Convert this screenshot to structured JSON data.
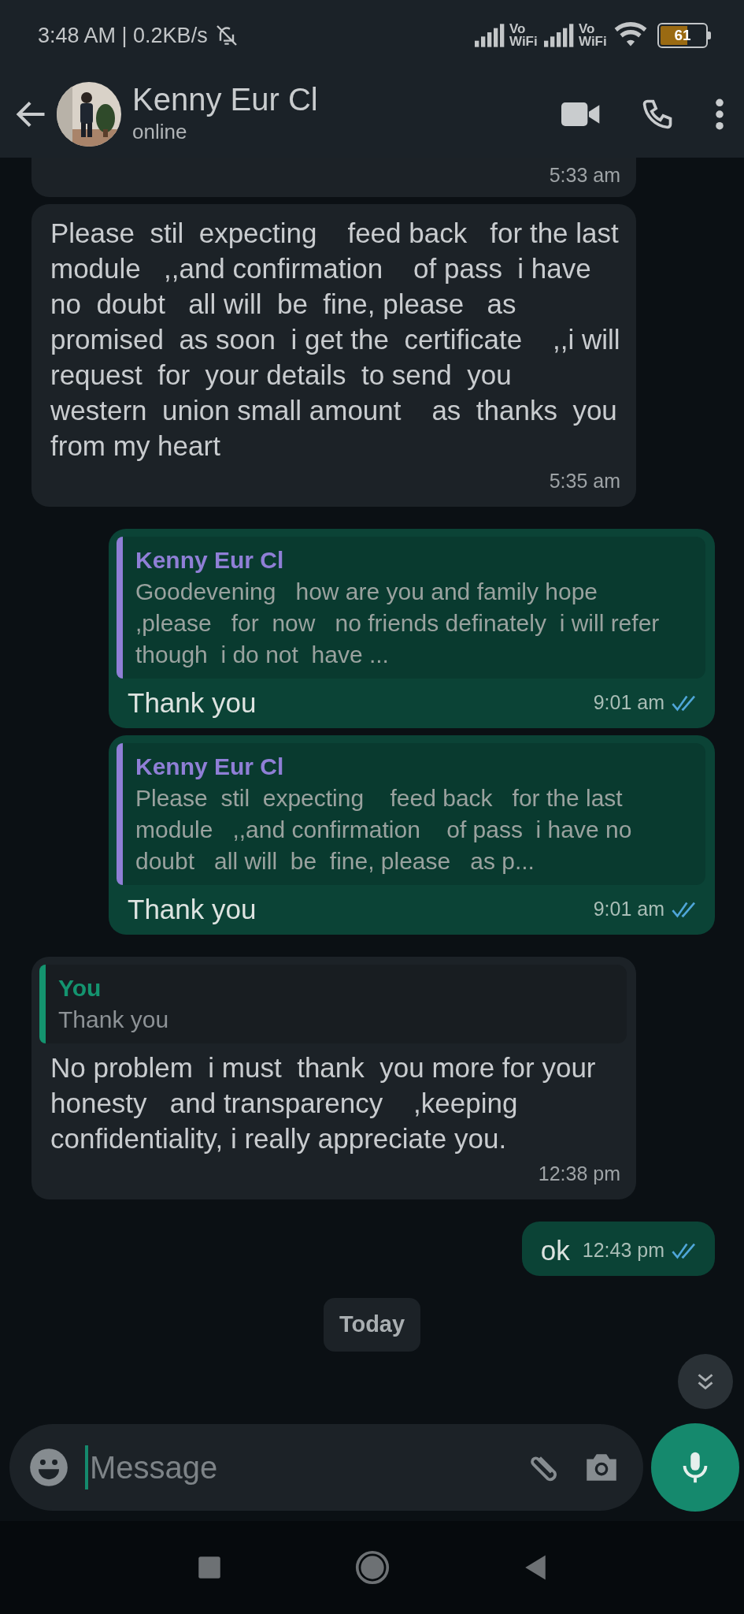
{
  "status_bar": {
    "time_speed": "3:48 AM | 0.2KB/s",
    "network_labels": [
      "Vo WiFi",
      "Vo WiFi"
    ],
    "battery": "61"
  },
  "header": {
    "contact_name": "Kenny Eur Cl",
    "status": "online"
  },
  "messages": [
    {
      "kind": "incoming",
      "clipped": true,
      "time": "5:33 am"
    },
    {
      "kind": "incoming",
      "clipped": false,
      "text": "Please  stil  expecting    feed back   for the last   module   ,,and confirmation    of pass  i have no  doubt   all will  be  fine, please   as promised  as soon  i get the  certificate    ,,i will request  for  your details  to send  you  western  union small amount    as  thanks  you  from my heart",
      "time": "5:35 am"
    },
    {
      "kind": "outgoing",
      "clipped": false,
      "quote": {
        "author": "Kenny Eur Cl",
        "color": "#8f7fd6",
        "text": "Goodevening   how are you and family hope   ,please   for  now   no friends definately  i will refer  though  i do not  have ..."
      },
      "text": "Thank you",
      "time": "9:01 am",
      "read": true
    },
    {
      "kind": "outgoing",
      "clipped": false,
      "quote": {
        "author": "Kenny Eur Cl",
        "color": "#8f7fd6",
        "text": "Please  stil  expecting    feed back   for the last   module   ,,and confirmation    of pass  i have no  doubt   all will  be  fine, please   as p..."
      },
      "text": "Thank you",
      "time": "9:01 am",
      "read": true
    },
    {
      "kind": "incoming",
      "clipped": false,
      "quote": {
        "author": "You",
        "color": "#14946f",
        "text": "Thank you"
      },
      "text": "No problem  i must  thank  you more for your  honesty   and transparency    ,keeping  confidentiality, i really appreciate you.",
      "time": "12:38 pm"
    },
    {
      "kind": "outgoing",
      "clipped": false,
      "text": "ok",
      "time": "12:43 pm",
      "read": true
    }
  ],
  "date_chip": "Today",
  "composer": {
    "placeholder": "Message"
  }
}
